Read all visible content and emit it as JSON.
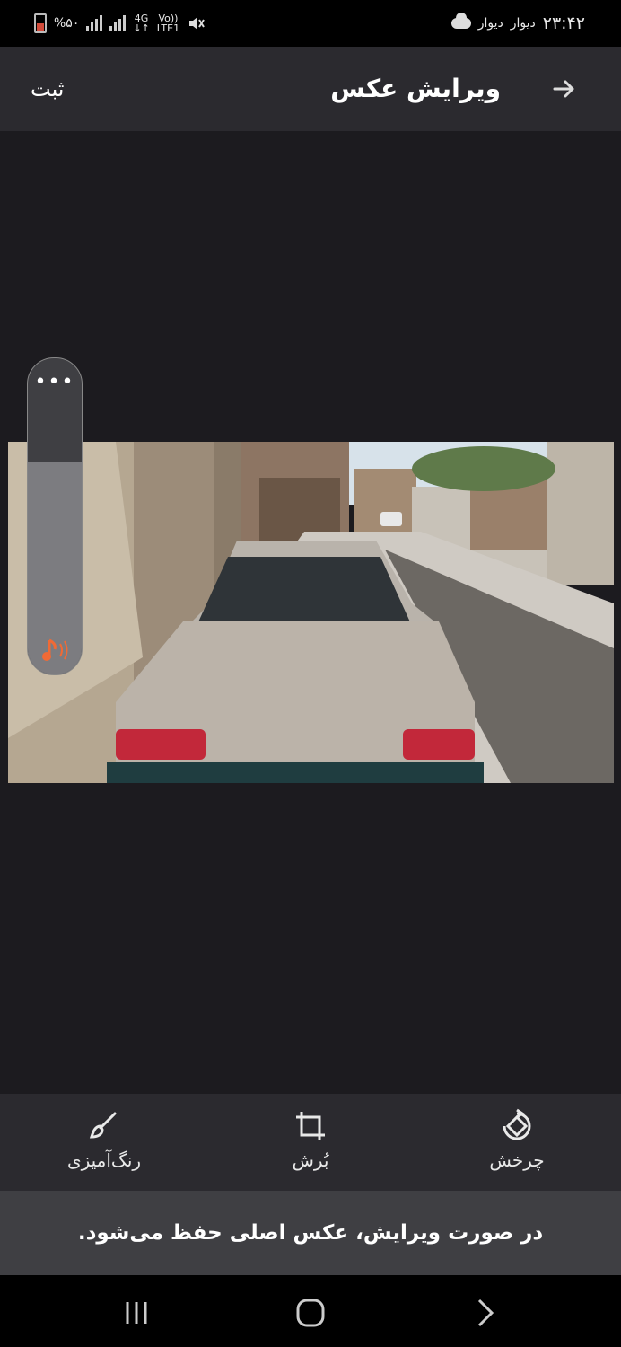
{
  "status_bar": {
    "time": "۲۳:۴۲",
    "notif_1": "دیوار",
    "notif_2": "دیوار",
    "battery": "%۵۰",
    "network": "4G",
    "volte": "Vo))",
    "lte": "LTE1",
    "icons": [
      "battery-icon",
      "signal-icon",
      "signal-icon",
      "mute-icon",
      "cloud-icon"
    ]
  },
  "header": {
    "title": "ویرایش عکس",
    "submit_label": "ثبت",
    "back_icon": "arrow-right-icon"
  },
  "photo": {
    "description_icon": "car-photo"
  },
  "volume": {
    "more_label": "•••",
    "level": 0.67,
    "icon": "music-note-icon",
    "accent": "#f06a35"
  },
  "toolbar": {
    "tools": [
      {
        "label": "رنگ‌آمیزی",
        "icon": "brush-icon"
      },
      {
        "label": "بُرش",
        "icon": "crop-icon"
      },
      {
        "label": "چرخش",
        "icon": "rotate-icon"
      }
    ]
  },
  "info": {
    "text": "در صورت ویرایش، عکس اصلی حفظ می‌شود."
  },
  "nav": {
    "icons": [
      "recents-icon",
      "home-icon",
      "back-icon"
    ]
  }
}
